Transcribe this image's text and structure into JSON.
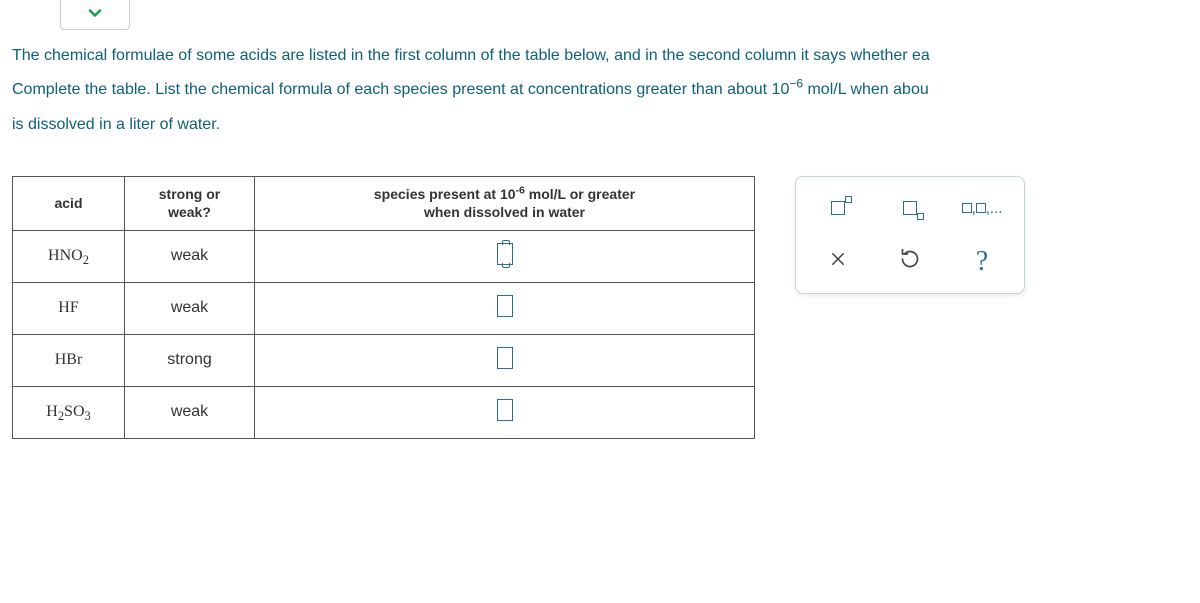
{
  "instruction": {
    "line1": "The chemical formulae of some acids are listed in the first column of the table below, and in the second column it says whether ea",
    "line2_a": "Complete the table. List the chemical formula of each species present at concentrations greater than about 10",
    "line2_exp": "−6",
    "line2_b": " mol/L when abou",
    "line3": "is dissolved in a liter of water."
  },
  "table": {
    "headers": {
      "acid": "acid",
      "strength": "strong or\nweak?",
      "species_a": "species present at 10",
      "species_exp": "-6",
      "species_b": " mol/L or greater",
      "species_c": "when dissolved in water"
    },
    "rows": [
      {
        "formula_html": "HNO<sub>2</sub>",
        "strength": "weak",
        "active": true
      },
      {
        "formula_html": "HF",
        "strength": "weak",
        "active": false
      },
      {
        "formula_html": "HBr",
        "strength": "strong",
        "active": false
      },
      {
        "formula_html": "H<sub>2</sub>SO<sub>3</sub>",
        "strength": "weak",
        "active": false
      }
    ]
  },
  "tools": {
    "superscript": "superscript",
    "subscript": "subscript",
    "list": "list-input",
    "clear": "clear",
    "reset": "reset",
    "help": "help",
    "help_label": "?"
  }
}
